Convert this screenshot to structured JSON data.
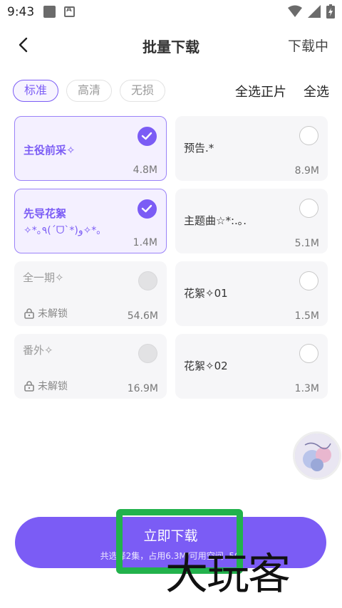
{
  "status": {
    "time": "9:43"
  },
  "header": {
    "title": "批量下载",
    "downloading": "下载中"
  },
  "quality": {
    "options": [
      "标准",
      "高清",
      "无损"
    ],
    "selected": "标准"
  },
  "actions": {
    "select_positive": "全选正片",
    "select_all": "全选"
  },
  "items": [
    {
      "title": "主役前采✧",
      "title2": "",
      "size": "4.8M",
      "state": "checked"
    },
    {
      "title": "预告.*",
      "title2": "",
      "size": "8.9M",
      "state": "unchecked"
    },
    {
      "title": "先导花絮",
      "title2": "✧*｡٩(ˊᗜˋ*)و✧*｡",
      "size": "1.4M",
      "state": "checked"
    },
    {
      "title": "主题曲☆*:.｡.",
      "title2": "",
      "size": "5.1M",
      "state": "unchecked"
    },
    {
      "title": "全一期✧",
      "title2": "",
      "size": "54.6M",
      "state": "locked",
      "lock_label": "未解锁"
    },
    {
      "title": "花絮✧01",
      "title2": "",
      "size": "1.5M",
      "state": "unchecked"
    },
    {
      "title": "番外✧",
      "title2": "",
      "size": "16.9M",
      "state": "locked",
      "lock_label": "未解锁"
    },
    {
      "title": "花絮✧02",
      "title2": "",
      "size": "1.3M",
      "state": "unchecked"
    }
  ],
  "download": {
    "label": "立即下载",
    "summary": "共选择2集，占用6.3M/可用空间 .5G"
  },
  "watermark": "大玩客",
  "colors": {
    "accent": "#7b5cf5",
    "highlight": "#22b24c"
  }
}
